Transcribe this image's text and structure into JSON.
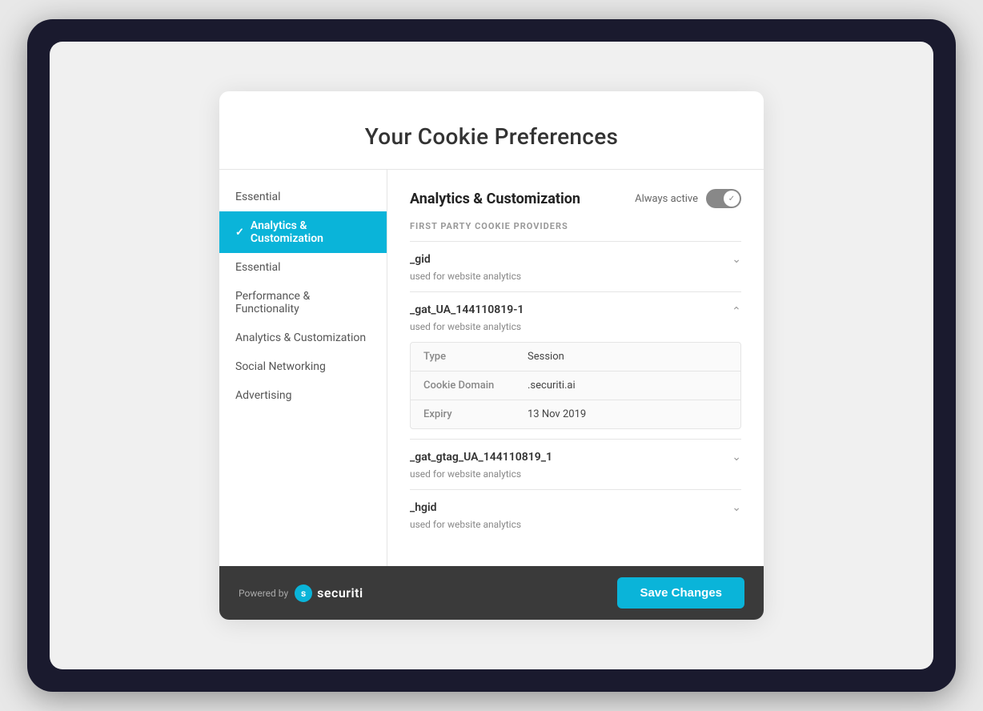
{
  "page": {
    "title": "Your Cookie Preferences"
  },
  "sidebar": {
    "items": [
      {
        "id": "essential-top",
        "label": "Essential",
        "active": false,
        "showCheck": false
      },
      {
        "id": "analytics-customization-active",
        "label": "Analytics & Customization",
        "active": true,
        "showCheck": true
      },
      {
        "id": "essential",
        "label": "Essential",
        "active": false,
        "showCheck": false
      },
      {
        "id": "performance-functionality",
        "label": "Performance & Functionality",
        "active": false,
        "showCheck": false
      },
      {
        "id": "analytics-customization",
        "label": "Analytics & Customization",
        "active": false,
        "showCheck": false
      },
      {
        "id": "social-networking",
        "label": "Social Networking",
        "active": false,
        "showCheck": false
      },
      {
        "id": "advertising",
        "label": "Advertising",
        "active": false,
        "showCheck": false
      }
    ]
  },
  "content": {
    "title": "Analytics & Customization",
    "always_active_label": "Always active",
    "section_label": "FIRST PARTY COOKIE PROVIDERS",
    "cookies": [
      {
        "id": "gid",
        "name": "_gid",
        "description": "used for website analytics",
        "expanded": false,
        "details": []
      },
      {
        "id": "gat_ua",
        "name": "_gat_UA_144110819-1",
        "description": "used for website analytics",
        "expanded": true,
        "details": [
          {
            "key": "Type",
            "value": "Session"
          },
          {
            "key": "Cookie Domain",
            "value": ".securiti.ai"
          },
          {
            "key": "Expiry",
            "value": "13 Nov 2019"
          }
        ]
      },
      {
        "id": "gat_gtag",
        "name": "_gat_gtag_UA_144110819_1",
        "description": "used for website analytics",
        "expanded": false,
        "details": []
      },
      {
        "id": "hgid",
        "name": "_hgid",
        "description": "used for website analytics",
        "expanded": false,
        "details": []
      }
    ]
  },
  "footer": {
    "powered_by_label": "Powered by",
    "logo_text": "securiti",
    "save_button_label": "Save Changes"
  },
  "colors": {
    "accent": "#0ab4d9",
    "active_sidebar_bg": "#0ab4d9",
    "footer_bg": "#3a3a3a"
  }
}
